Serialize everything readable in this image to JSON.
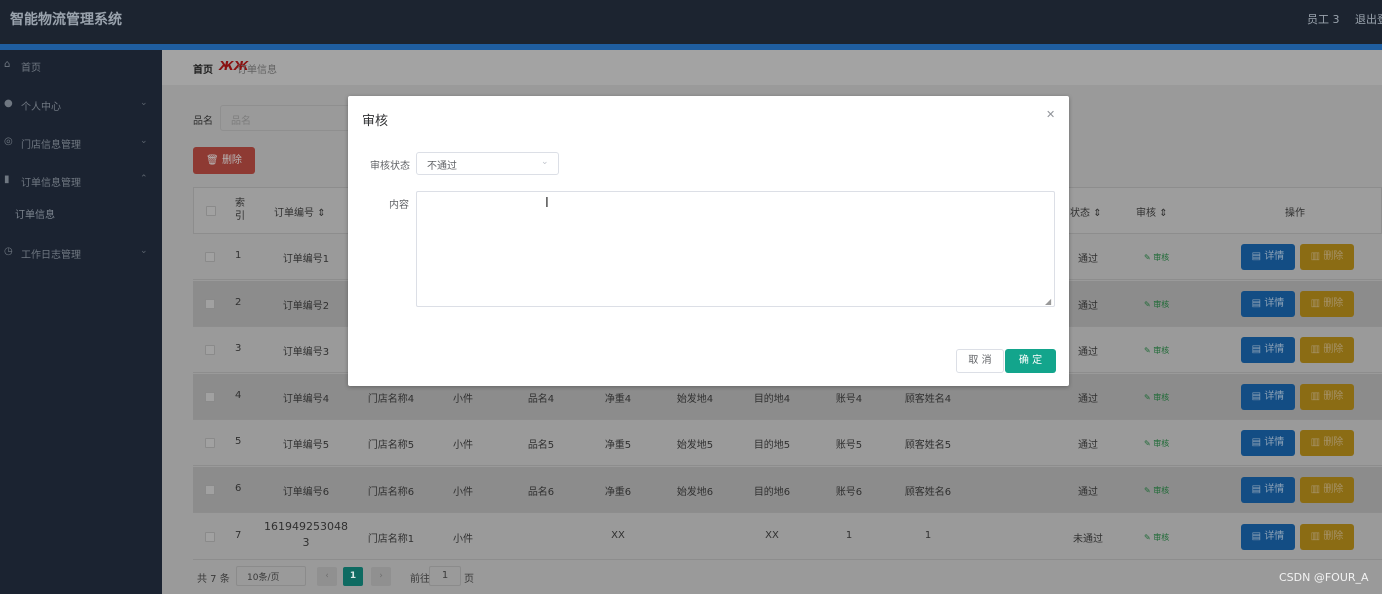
{
  "header": {
    "title": "智能物流管理系统",
    "user": "员工 3",
    "logout": "退出登"
  },
  "sidebar": {
    "items": [
      {
        "label": "首页",
        "icon": "home-icon"
      },
      {
        "label": "个人中心",
        "icon": "user-icon"
      },
      {
        "label": "门店信息管理",
        "icon": "store-icon"
      },
      {
        "label": "订单信息管理",
        "icon": "bar-chart-icon"
      },
      {
        "label": "工作日志管理",
        "icon": "clock-icon"
      }
    ],
    "sub_item": "订单信息"
  },
  "breadcrumb": {
    "home": "首页",
    "separator": "ЖЖ",
    "current": "订单信息"
  },
  "search": {
    "label": "品名",
    "placeholder": "品名"
  },
  "delete_button": "删除",
  "table": {
    "headers": {
      "index": "索引",
      "order_no": "订单编号",
      "status": "状态",
      "audit": "审核",
      "ops": "操作"
    },
    "audit_label": "审核",
    "detail_label": "详情",
    "delete_label": "删除",
    "rows": [
      {
        "idx": "1",
        "order": "订单编号1",
        "store": "",
        "type": "",
        "name": "",
        "weight": "",
        "origin": "",
        "dest": "",
        "account": "",
        "customer": "",
        "status": "通过"
      },
      {
        "idx": "2",
        "order": "订单编号2",
        "store": "",
        "type": "",
        "name": "",
        "weight": "",
        "origin": "",
        "dest": "",
        "account": "",
        "customer": "",
        "status": "通过"
      },
      {
        "idx": "3",
        "order": "订单编号3",
        "store": "",
        "type": "",
        "name": "",
        "weight": "",
        "origin": "",
        "dest": "",
        "account": "",
        "customer": "",
        "status": "通过"
      },
      {
        "idx": "4",
        "order": "订单编号4",
        "store": "门店名称4",
        "type": "小件",
        "name": "品名4",
        "weight": "净重4",
        "origin": "始发地4",
        "dest": "目的地4",
        "account": "账号4",
        "customer": "顾客姓名4",
        "status": "通过"
      },
      {
        "idx": "5",
        "order": "订单编号5",
        "store": "门店名称5",
        "type": "小件",
        "name": "品名5",
        "weight": "净重5",
        "origin": "始发地5",
        "dest": "目的地5",
        "account": "账号5",
        "customer": "顾客姓名5",
        "status": "通过"
      },
      {
        "idx": "6",
        "order": "订单编号6",
        "store": "门店名称6",
        "type": "小件",
        "name": "品名6",
        "weight": "净重6",
        "origin": "始发地6",
        "dest": "目的地6",
        "account": "账号6",
        "customer": "顾客姓名6",
        "status": "通过"
      },
      {
        "idx": "7",
        "order": "1619492530483",
        "store": "门店名称1",
        "type": "小件",
        "name": "",
        "weight": "XX",
        "origin": "",
        "dest": "XX",
        "account": "1",
        "customer": "1",
        "status": "未通过"
      }
    ]
  },
  "pager": {
    "total": "共 7 条",
    "size": "10条/页",
    "current": "1",
    "goto": "前往",
    "goto_value": "1",
    "page": "页"
  },
  "watermark": "CSDN @FOUR_A",
  "modal": {
    "title": "审核",
    "status_label": "审核状态",
    "status_value": "不通过",
    "content_label": "内容",
    "cancel": "取 消",
    "confirm": "确 定"
  }
}
